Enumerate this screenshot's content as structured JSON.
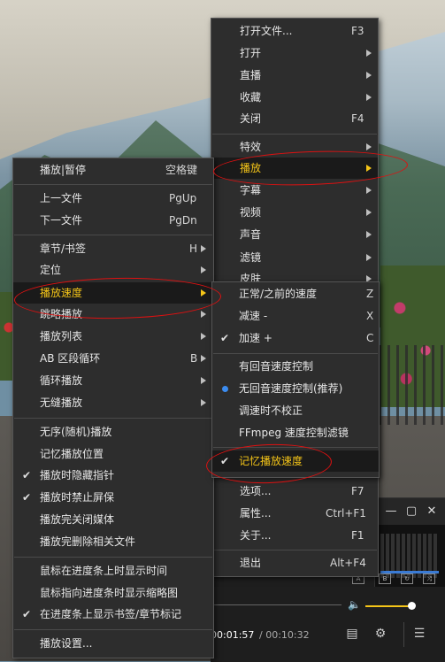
{
  "main_menu": {
    "items": [
      {
        "label": "打开文件...",
        "shortcut": "F3"
      },
      {
        "label": "打开",
        "shortcut": ""
      },
      {
        "label": "直播",
        "shortcut": ""
      },
      {
        "label": "收藏",
        "shortcut": ""
      },
      {
        "label": "关闭",
        "shortcut": "F4"
      },
      {
        "label": "特效",
        "shortcut": ""
      },
      {
        "label": "播放",
        "shortcut": ""
      },
      {
        "label": "字幕",
        "shortcut": ""
      },
      {
        "label": "视频",
        "shortcut": ""
      },
      {
        "label": "声音",
        "shortcut": ""
      },
      {
        "label": "滤镜",
        "shortcut": ""
      },
      {
        "label": "皮肤",
        "shortcut": ""
      },
      {
        "label": "选项...",
        "shortcut": "F7"
      },
      {
        "label": "属性...",
        "shortcut": "Ctrl+F1"
      },
      {
        "label": "关于...",
        "shortcut": "F1"
      },
      {
        "label": "退出",
        "shortcut": "Alt+F4"
      }
    ]
  },
  "play_menu": {
    "items": [
      {
        "label": "播放|暂停",
        "shortcut": "空格键"
      },
      {
        "label": "上一文件",
        "shortcut": "PgUp"
      },
      {
        "label": "下一文件",
        "shortcut": "PgDn"
      },
      {
        "label": "章节/书签",
        "shortcut": "H"
      },
      {
        "label": "定位",
        "shortcut": ""
      },
      {
        "label": "播放速度",
        "shortcut": ""
      },
      {
        "label": "跳略播放",
        "shortcut": ""
      },
      {
        "label": "播放列表",
        "shortcut": ""
      },
      {
        "label": "AB 区段循环",
        "shortcut": "B"
      },
      {
        "label": "循环播放",
        "shortcut": ""
      },
      {
        "label": "无缝播放",
        "shortcut": ""
      },
      {
        "label": "无序(随机)播放",
        "shortcut": ""
      },
      {
        "label": "记忆播放位置",
        "shortcut": ""
      },
      {
        "label": "播放时隐藏指针",
        "shortcut": ""
      },
      {
        "label": "播放时禁止屏保",
        "shortcut": ""
      },
      {
        "label": "播放完关闭媒体",
        "shortcut": ""
      },
      {
        "label": "播放完删除相关文件",
        "shortcut": ""
      },
      {
        "label": "鼠标在进度条上时显示时间",
        "shortcut": ""
      },
      {
        "label": "鼠标指向进度条时显示缩略图",
        "shortcut": ""
      },
      {
        "label": "在进度条上显示书签/章节标记",
        "shortcut": ""
      },
      {
        "label": "播放设置...",
        "shortcut": ""
      }
    ]
  },
  "speed_menu": {
    "items": [
      {
        "label": "正常/之前的速度",
        "shortcut": "Z"
      },
      {
        "label": "减速 -",
        "shortcut": "X"
      },
      {
        "label": "加速 +",
        "shortcut": "C"
      },
      {
        "label": "有回音速度控制",
        "shortcut": ""
      },
      {
        "label": "无回音速度控制(推荐)",
        "shortcut": ""
      },
      {
        "label": "调速时不校正",
        "shortcut": ""
      },
      {
        "label": "FFmpeg 速度控制滤镜",
        "shortcut": ""
      },
      {
        "label": "记忆播放速度",
        "shortcut": ""
      }
    ]
  },
  "player": {
    "time_current": "00:01:57",
    "time_total": "/ 00:10:32",
    "volume_level": 0.95
  },
  "colors": {
    "highlight": "#f5c518",
    "annotation": "#d11111",
    "radio": "#3b8cf0"
  }
}
